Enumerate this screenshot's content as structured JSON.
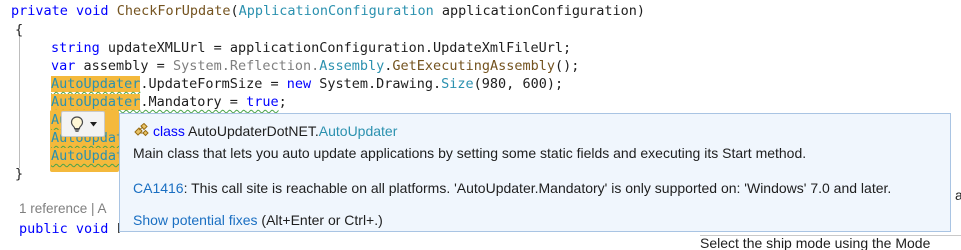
{
  "code": {
    "signature": {
      "kw1": "private",
      "kw2": "void",
      "method": "CheckForUpdate",
      "paren_open": "(",
      "param_type": "ApplicationConfiguration",
      "param_name": " applicationConfiguration)"
    },
    "open_brace": "{",
    "line1": {
      "kw": "string",
      "rest": " updateXMLUrl = applicationConfiguration.UpdateXmlFileUrl;"
    },
    "line2": {
      "kw": "var",
      "rest1": " assembly = ",
      "gray": "System.Reflection.",
      "type1": "Assembly",
      "dot": ".",
      "method": "GetExecutingAssembly",
      "rest2": "();"
    },
    "line3": {
      "hl": "AutoUpdater",
      "mid": ".UpdateFormSize = ",
      "kw": "new",
      "rest1": " System.Drawing.",
      "type": "Size",
      "rest2": "(980, 600);"
    },
    "line4": {
      "hl": "AutoUpdater",
      "rest": ".Mandatory = ",
      "kw": "true",
      "end": ";"
    },
    "line5_fragment": "Au",
    "line6_fragment": "AutoUpdat",
    "line7_fragment": "AutoUpdat",
    "close_brace": "}",
    "references": "1 reference | A",
    "next_signature": {
      "kw1": "public",
      "kw2": "void",
      "rest": " F"
    }
  },
  "quick_actions": {
    "icon": "lightbulb-icon",
    "dropdown_icon": "chevron-down-icon"
  },
  "tooltip": {
    "icon": "class-icon",
    "kind": "class",
    "namespace": "AutoUpdaterDotNET.",
    "class_name": "AutoUpdater",
    "description": "Main class that lets you auto update applications by setting some static fields and executing its Start method.",
    "diag_code": "CA1416",
    "diag_message": ": This call site is reachable on all platforms. 'AutoUpdater.Mandatory' is only supported on: 'Windows' 7.0 and later.",
    "fixes_link": "Show potential fixes",
    "fixes_shortcut": " (Alt+Enter or Ctrl+.)"
  },
  "background_panel": {
    "fragment_right": "ay",
    "bottom_text": "Select the ship mode using the Mode"
  },
  "colors": {
    "keyword": "#0000ff",
    "type": "#2b91af",
    "method": "#74531f",
    "highlight": "#f4b93c",
    "tooltip_bg": "#f0f6fd",
    "link": "#1a6fc2"
  }
}
